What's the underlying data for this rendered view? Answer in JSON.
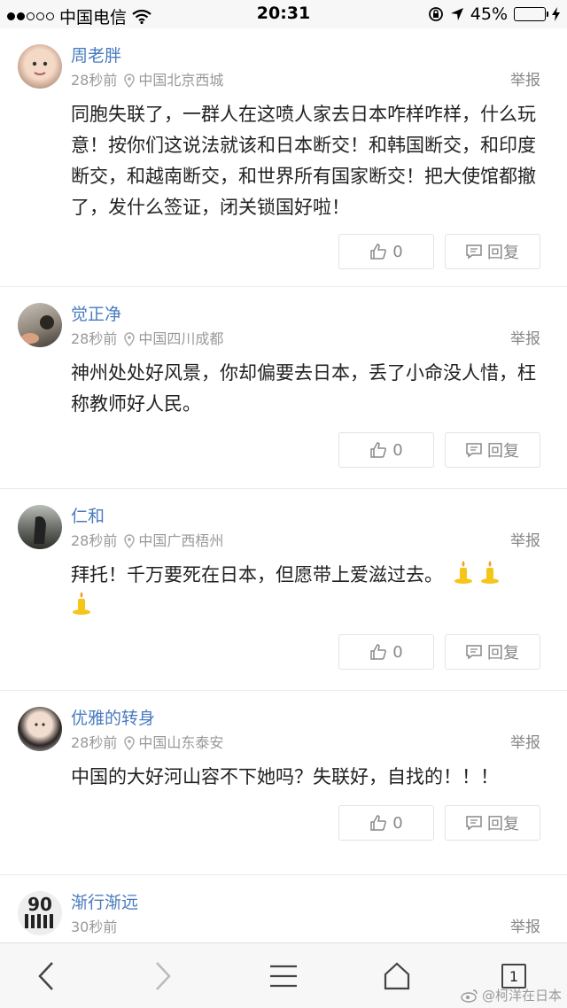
{
  "status_bar": {
    "carrier": "中国电信",
    "time": "20:31",
    "battery": "45%",
    "battery_level": 0.45,
    "icons": [
      "signal-dots-icon",
      "wifi-icon",
      "rotation-lock-icon",
      "location-arrow-icon",
      "battery-icon",
      "charging-bolt-icon"
    ]
  },
  "comments": [
    {
      "user": "周老胖",
      "time": "28秒前",
      "location": "中国北京西城",
      "report": "举报",
      "text": "同胞失联了，一群人在这喷人家去日本咋样咋样，什么玩意！按你们这说法就该和日本断交！和韩国断交，和印度断交，和越南断交，和世界所有国家断交！把大使馆都撤了，发什么签证，闭关锁国好啦！",
      "likes": "0",
      "reply": "回复"
    },
    {
      "user": "觉正净",
      "time": "28秒前",
      "location": "中国四川成都",
      "report": "举报",
      "text": "神州处处好风景，你却偏要去日本，丢了小命没人惜，枉称教师好人民。",
      "likes": "0",
      "reply": "回复"
    },
    {
      "user": "仁和",
      "time": "28秒前",
      "location": "中国广西梧州",
      "report": "举报",
      "text": "拜托！千万要死在日本，但愿带上爱滋过去。",
      "emoji_count": 3,
      "likes": "0",
      "reply": "回复"
    },
    {
      "user": "优雅的转身",
      "time": "28秒前",
      "location": "中国山东泰安",
      "report": "举报",
      "text": "中国的大好河山容不下她吗？失联好，自找的！！！",
      "likes": "0",
      "reply": "回复"
    },
    {
      "user": "渐行渐远",
      "time": "30秒前",
      "report": "举报"
    }
  ],
  "bottom_bar": {
    "tab_count": "1",
    "icons": [
      "back-icon",
      "forward-icon",
      "menu-icon",
      "home-icon",
      "tabs-icon"
    ]
  },
  "watermark": "@柯洋在日本",
  "colors": {
    "username": "#4a7bbf",
    "battery": "#f5c518",
    "muted": "#999999"
  }
}
